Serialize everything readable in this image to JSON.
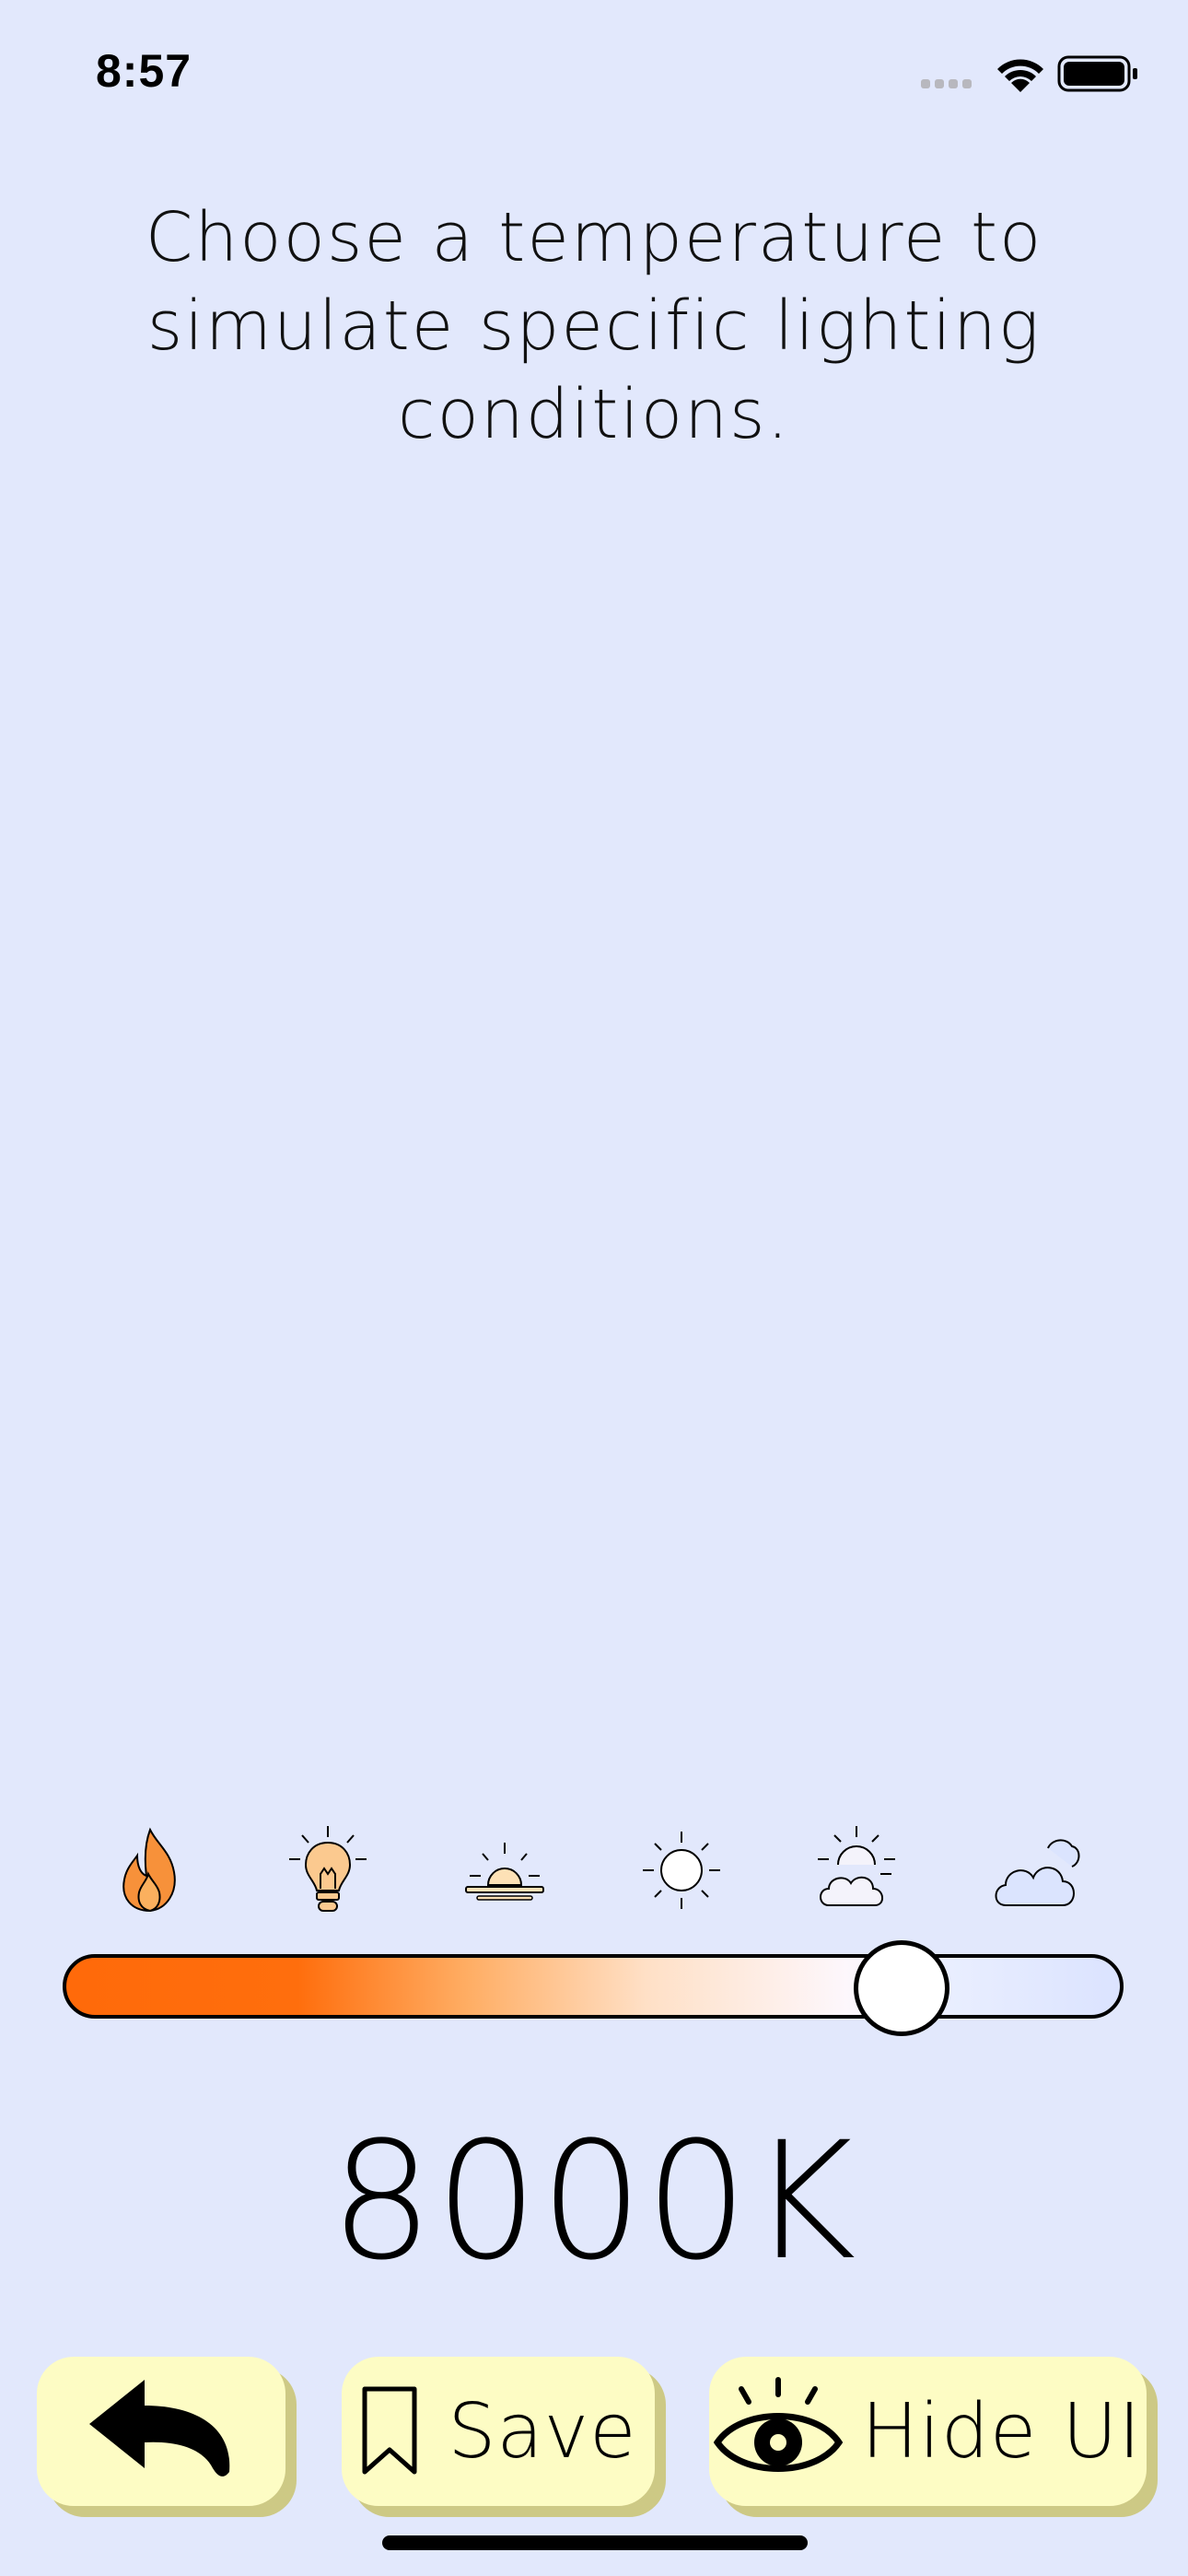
{
  "status_bar": {
    "time": "8:57",
    "icons": [
      "cellular-signal-icon",
      "wifi-icon",
      "battery-icon"
    ]
  },
  "instruction": {
    "line1": "Choose a temperature to",
    "line2": "simulate specific lighting",
    "line3": "conditions."
  },
  "presets": [
    {
      "icon": "flame-icon",
      "color": "#f7913a"
    },
    {
      "icon": "lightbulb-icon",
      "color": "#fbc98f"
    },
    {
      "icon": "sunrise-icon",
      "color": "#fde1b6"
    },
    {
      "icon": "sun-icon",
      "color": "#ffffff"
    },
    {
      "icon": "partly-cloudy-icon",
      "color": "#f4f3fb"
    },
    {
      "icon": "cloudy-icon",
      "color": "#dbe4fe"
    }
  ],
  "slider": {
    "value_fraction": 0.82,
    "colors": [
      "#ff6a0a",
      "#ffad63",
      "#ffe0c6",
      "#fdf7fc",
      "#dbe3ff"
    ]
  },
  "temperature": {
    "value": "8000K"
  },
  "buttons": {
    "back_icon": "back-arrow-icon",
    "save_icon": "bookmark-icon",
    "save_label": "Save",
    "hide_icon": "eye-icon",
    "hide_label": "Hide UI",
    "background": "#fdfcc4",
    "shadow": "#cdc985"
  },
  "background_color": "#e2e8fc"
}
